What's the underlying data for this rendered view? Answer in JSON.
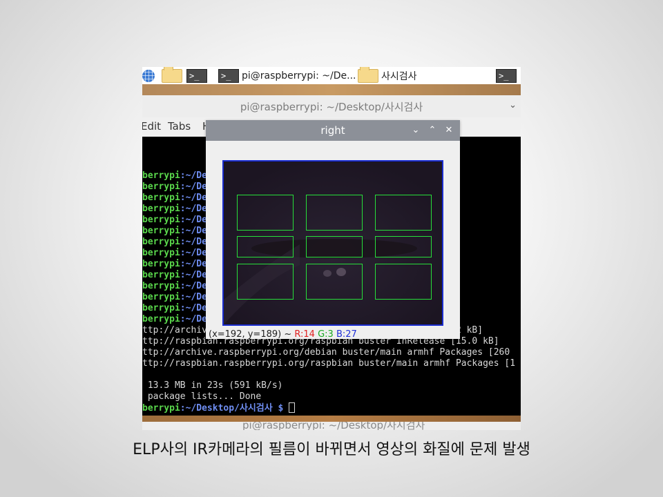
{
  "taskbar": {
    "items": [
      {
        "icon": "web-browser-icon"
      },
      {
        "icon": "file-manager-icon"
      },
      {
        "icon": "terminal-icon",
        "glyph": ">_"
      },
      {
        "icon": "terminal-icon",
        "glyph": ">_",
        "label": "pi@raspberrypi: ~/De..."
      },
      {
        "icon": "folder-icon",
        "label": "사시검사"
      },
      {
        "icon": "terminal-icon",
        "glyph": ">_"
      }
    ]
  },
  "terminal": {
    "title": "pi@raspberrypi: ~/Desktop/사시검사",
    "chevron": "⌄",
    "menu": [
      "Edit",
      "Tabs",
      "H"
    ],
    "prompt_fragment_green": "berrypi",
    "prompt_fragment_blue": ":~/De",
    "prompt_line_count": 14,
    "lines": [
      "ttp://archive.raspberrypi.org/debian buster InRelease [32.2 kB]",
      "ttp://raspbian.raspberrypi.org/raspbian buster InRelease [15.0 kB]",
      "ttp://archive.raspberrypi.org/debian buster/main armhf Packages [260",
      "ttp://raspbian.raspberrypi.org/raspbian buster/main armhf Packages [1",
      "",
      " 13.3 MB in 23s (591 kB/s)",
      " package lists... Done"
    ],
    "last_prompt_green": "berrypi",
    "last_prompt_blue": ":~/Desktop/사시검사 $ ",
    "second_window_title": "pi@raspberrypi: ~/Desktop/사시검사"
  },
  "image_window": {
    "title": "right",
    "buttons": {
      "minimize": "⌄",
      "maximize": "⌃",
      "close": "✕"
    },
    "status": {
      "coords": "(x=192, y=189) ~ ",
      "r": "R:14",
      "g": "G:3",
      "b": "B:27"
    },
    "roi_count": 9,
    "roi_color": "#27e03a",
    "frame_color": "#1a2cd0"
  },
  "caption": "ELP사의 IR카메라의 필름이 바뀌면서 영상의 화질에 문제 발생"
}
